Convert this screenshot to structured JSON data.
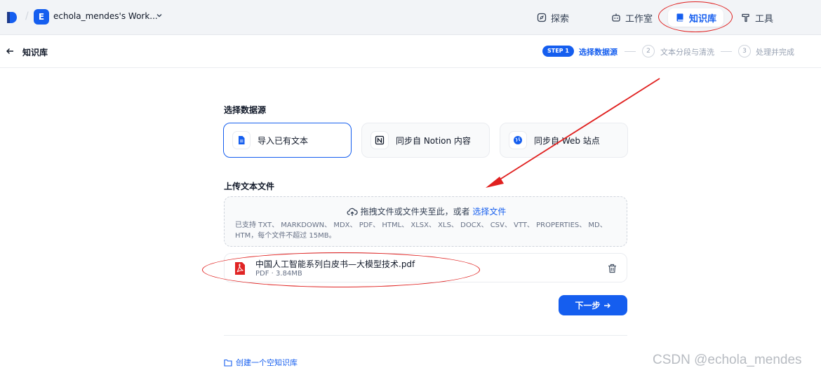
{
  "topbar": {
    "workspace_initial": "E",
    "workspace_name": "echola_mendes's Work...",
    "nav": [
      {
        "label": "探索",
        "icon": "compass-icon",
        "active": false
      },
      {
        "label": "工作室",
        "icon": "robot-icon",
        "active": false
      },
      {
        "label": "知识库",
        "icon": "book-icon",
        "active": true
      },
      {
        "label": "工具",
        "icon": "hammer-icon",
        "active": false
      }
    ]
  },
  "subheader": {
    "title": "知识库",
    "steps": [
      {
        "badge": "STEP 1",
        "label": "选择数据源",
        "active": true
      },
      {
        "num": "2",
        "label": "文本分段与清洗",
        "active": false
      },
      {
        "num": "3",
        "label": "处理并完成",
        "active": false
      }
    ]
  },
  "main": {
    "source_title": "选择数据源",
    "sources": [
      {
        "label": "导入已有文本",
        "icon": "document-icon",
        "active": true
      },
      {
        "label": "同步自 Notion 内容",
        "icon": "notion-icon",
        "active": false
      },
      {
        "label": "同步自 Web 站点",
        "icon": "web-icon",
        "active": false
      }
    ],
    "upload_title": "上传文本文件",
    "dropzone": {
      "text": "拖拽文件或文件夹至此，或者",
      "link": "选择文件",
      "hint": "已支持 TXT、 MARKDOWN、 MDX、 PDF、 HTML、 XLSX、 XLS、 DOCX、 CSV、 VTT、 PROPERTIES、 MD、 HTM，每个文件不超过 15MB。"
    },
    "file": {
      "name": "中国人工智能系列白皮书—大模型技术.pdf",
      "type": "PDF",
      "size": "3.84MB"
    },
    "next_button": "下一步",
    "create_empty": "创建一个空知识库"
  },
  "watermark": "CSDN @echola_mendes",
  "colors": {
    "accent": "#155eef",
    "annotation": "#e0201f"
  }
}
